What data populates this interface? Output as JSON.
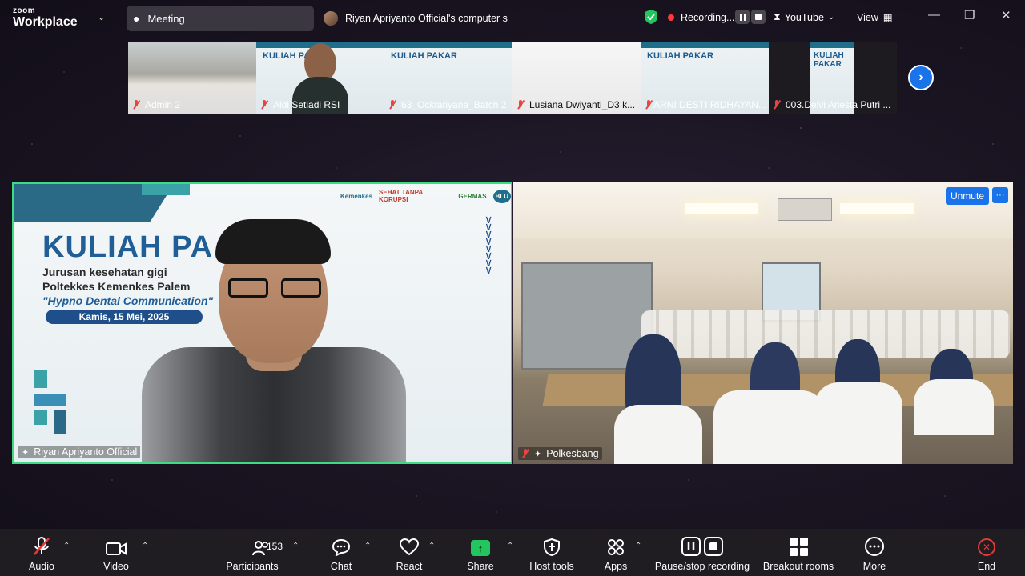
{
  "brand": {
    "line1": "zoom",
    "line2": "Workplace"
  },
  "topbar": {
    "meeting_label": "Meeting",
    "share_title": "Riyan Apriyanto Official's computer s",
    "recording_label": "Recording...",
    "stream_label": "YouTube",
    "view_label": "View"
  },
  "thumbnails": [
    {
      "name": "Admin 2"
    },
    {
      "name": "Aldi Setiadi RSI"
    },
    {
      "name": "63_Ocktariyana_Batch 2"
    },
    {
      "name": "Lusiana Dwiyanti_D3 k..."
    },
    {
      "name": "ARNI DESTI RIDHAYAN..."
    },
    {
      "name": "003.Delvi Ariesta Putri ..."
    }
  ],
  "thumb_slide_title": "KULIAH PAKAR",
  "main_left": {
    "name": "Riyan Apriyanto Official",
    "slide": {
      "title": "KULIAH PA",
      "line1": "Jurusan kesehatan gigi",
      "line2": "Poltekkes Kemenkes Palem",
      "line3": "\"Hypno Dental Communication\"",
      "date": "Kamis, 15 Mei, 2025",
      "logo1": "Kemenkes",
      "logo2": "SEHAT TANPA KORUPSI",
      "logo3": "GERMAS",
      "logo4": "BLU"
    }
  },
  "main_right": {
    "name": "Polkesbang",
    "unmute_label": "Unmute",
    "more_label": "···"
  },
  "toolbar": {
    "audio": "Audio",
    "video": "Video",
    "participants": "Participants",
    "participants_count": "153",
    "chat": "Chat",
    "react": "React",
    "share": "Share",
    "host_tools": "Host tools",
    "apps": "Apps",
    "pause_stop": "Pause/stop recording",
    "breakout": "Breakout rooms",
    "more": "More",
    "end": "End"
  },
  "colors": {
    "accent": "#1a73e8",
    "active_border": "#3ddc84",
    "share": "#22c55e",
    "end": "#e53935"
  }
}
